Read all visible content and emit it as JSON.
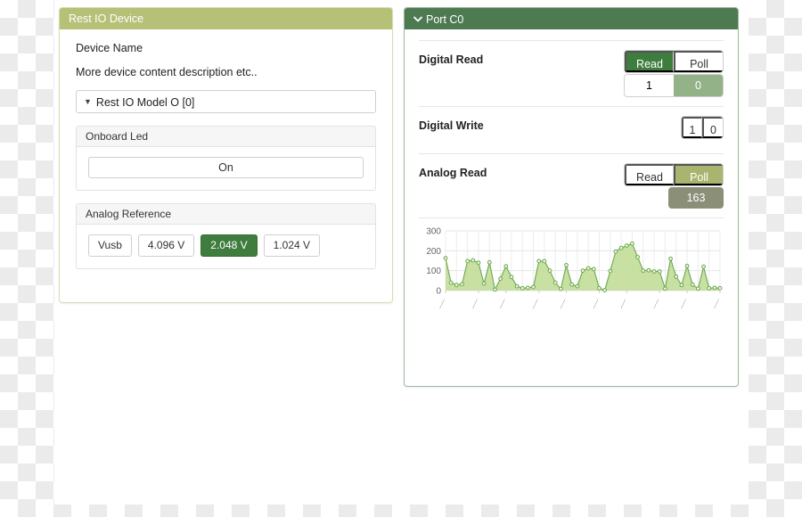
{
  "device_panel": {
    "title": "Rest IO Device",
    "device_name_label": "Device Name",
    "description": "More device content description etc..",
    "dropdown": {
      "caret_icon": "caret-down-icon",
      "selected": "Rest IO Model O [0]"
    },
    "onboard_led": {
      "title": "Onboard Led",
      "button_label": "On"
    },
    "analog_reference": {
      "title": "Analog Reference",
      "options": [
        {
          "label": "Vusb",
          "active": false
        },
        {
          "label": "4.096 V",
          "active": false
        },
        {
          "label": "2.048 V",
          "active": true
        },
        {
          "label": "1.024 V",
          "active": false
        }
      ]
    }
  },
  "port_panel": {
    "title": "Port C0",
    "chevron_icon": "chevron-down-icon",
    "digital_read": {
      "label": "Digital Read",
      "mode_options": [
        "Read",
        "Poll"
      ],
      "mode_selected": "Read",
      "value_options": [
        "1",
        "0"
      ],
      "value_selected": "0"
    },
    "digital_write": {
      "label": "Digital Write",
      "value_options": [
        "1",
        "0"
      ],
      "value_selected": ""
    },
    "analog_read": {
      "label": "Analog Read",
      "mode_options": [
        "Read",
        "Poll"
      ],
      "mode_selected": "Poll",
      "value": "163"
    }
  },
  "colors": {
    "header_olive": "#b7c077",
    "header_green": "#4e7a52",
    "active_dark_green": "#3f7d3f",
    "active_olive": "#a9b46e",
    "value_sage": "#93b287",
    "value_grey": "#8c8f78",
    "chart_line": "#6aa84f",
    "chart_fill": "#c3dd9a"
  },
  "chart_data": {
    "type": "area",
    "title": "",
    "xlabel": "",
    "ylabel": "",
    "ylim": [
      0,
      300
    ],
    "yticks": [
      0,
      100,
      200,
      300
    ],
    "grid": true,
    "legend": false,
    "xtick_labels": [
      "",
      "",
      "",
      "",
      "",
      "",
      "",
      "",
      "",
      ""
    ],
    "xtick_note": "rotated timestamp labels, illegible at this resolution",
    "series": [
      {
        "name": "Analog Read",
        "values": [
          163,
          40,
          28,
          32,
          148,
          152,
          140,
          35,
          142,
          5,
          60,
          122,
          68,
          22,
          12,
          14,
          18,
          148,
          148,
          100,
          40,
          8,
          128,
          30,
          22,
          100,
          112,
          108,
          12,
          2,
          98,
          196,
          214,
          226,
          236,
          168,
          100,
          102,
          96,
          96,
          10,
          160,
          70,
          28,
          124,
          30,
          10,
          120,
          12,
          14,
          12
        ]
      }
    ]
  }
}
